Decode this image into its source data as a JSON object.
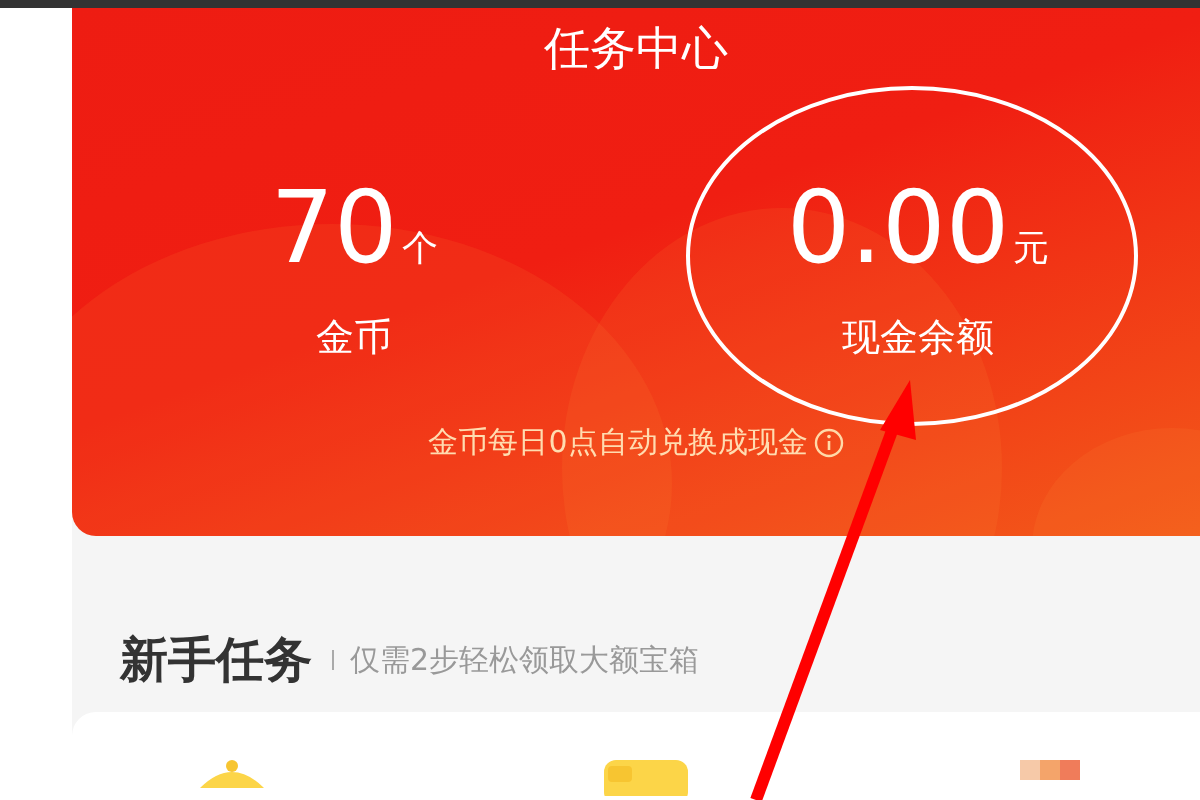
{
  "header": {
    "title": "任务中心"
  },
  "stats": [
    {
      "value": "70",
      "unit": "个",
      "label": "金币"
    },
    {
      "value": "0.00",
      "unit": "元",
      "label": "现金余额"
    }
  ],
  "note": {
    "text": "金币每日0点自动兑换成现金"
  },
  "section": {
    "title": "新手任务",
    "subtitle": "仅需2步轻松领取大额宝箱"
  }
}
